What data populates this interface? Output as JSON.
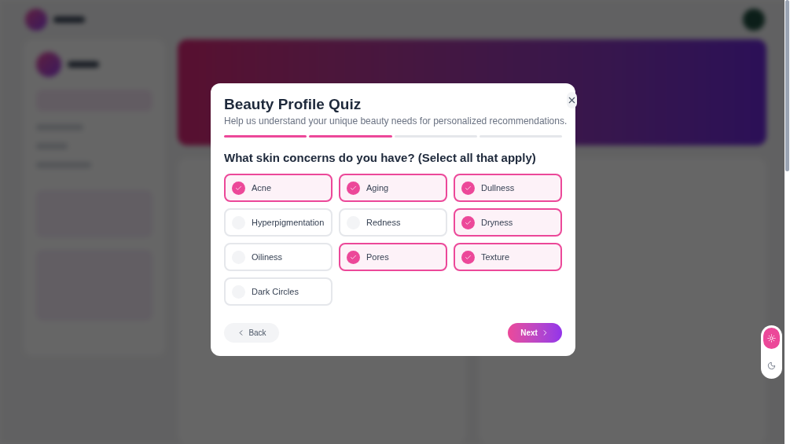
{
  "modal": {
    "title": "Beauty Profile Quiz",
    "subtitle": "Help us understand your unique beauty needs for personalized recommendations.",
    "steps": [
      {
        "done": true
      },
      {
        "done": true
      },
      {
        "done": false
      },
      {
        "done": false
      }
    ],
    "question": "What skin concerns do you have? (Select all that apply)",
    "options": [
      {
        "label": "Acne",
        "checked": true
      },
      {
        "label": "Aging",
        "checked": true
      },
      {
        "label": "Dullness",
        "checked": true
      },
      {
        "label": "Hyperpigmentation",
        "checked": false
      },
      {
        "label": "Redness",
        "checked": false
      },
      {
        "label": "Dryness",
        "checked": true
      },
      {
        "label": "Oiliness",
        "checked": false
      },
      {
        "label": "Pores",
        "checked": true
      },
      {
        "label": "Texture",
        "checked": true
      },
      {
        "label": "Dark Circles",
        "checked": false
      }
    ],
    "back": "Back",
    "next": "Next"
  },
  "theme_toggle": [
    {
      "kind": "light",
      "selected": true
    },
    {
      "kind": "dark",
      "selected": false
    }
  ]
}
